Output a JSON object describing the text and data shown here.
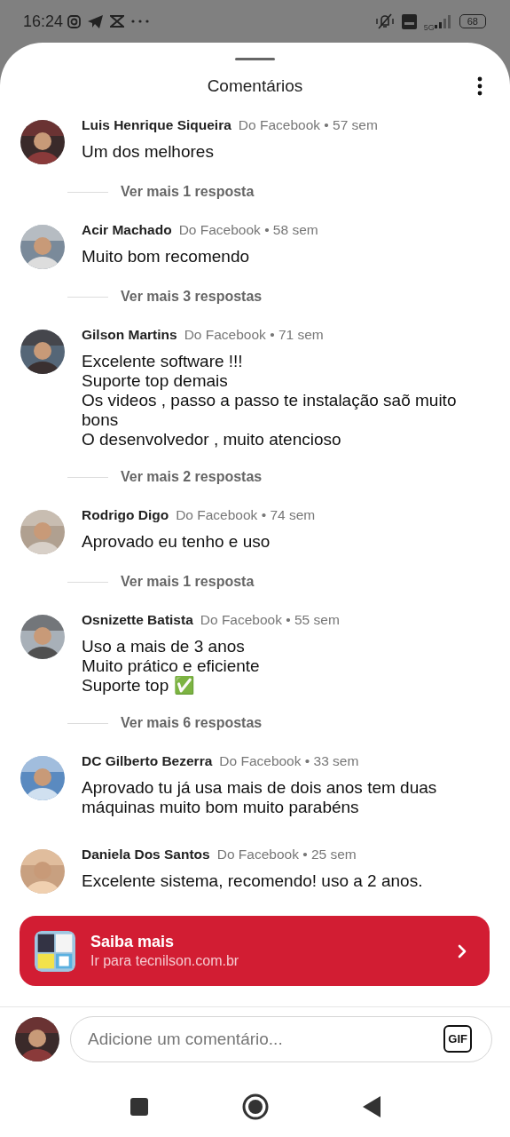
{
  "status_bar": {
    "time": "16:24",
    "network": "5G",
    "battery": "68"
  },
  "sheet": {
    "title": "Comentários"
  },
  "comments": [
    {
      "author": "Luis Henrique Siqueira",
      "meta": "Do Facebook • 57 sem",
      "lines": [
        "Um dos melhores"
      ],
      "replies": "Ver mais 1 resposta"
    },
    {
      "author": "Acir Machado",
      "meta": "Do Facebook • 58 sem",
      "lines": [
        "Muito bom recomendo"
      ],
      "replies": "Ver mais 3 respostas"
    },
    {
      "author": "Gilson Martins",
      "meta": "Do Facebook • 71 sem",
      "lines": [
        "Excelente software !!!",
        "Suporte top demais",
        "Os videos , passo a passo te instalação saõ muito bons",
        "O desenvolvedor , muito atencioso"
      ],
      "replies": "Ver mais 2 respostas"
    },
    {
      "author": "Rodrigo Digo",
      "meta": "Do Facebook • 74 sem",
      "lines": [
        "Aprovado eu tenho e uso"
      ],
      "replies": "Ver mais 1 resposta"
    },
    {
      "author": "Osnizette Batista",
      "meta": "Do Facebook • 55 sem",
      "lines": [
        "Uso a mais de 3 anos",
        "Muito prático e eficiente",
        "Suporte top ✅"
      ],
      "replies": "Ver mais 6 respostas"
    },
    {
      "author": "DC Gilberto Bezerra",
      "meta": "Do Facebook • 33 sem",
      "lines": [
        "Aprovado tu já usa mais de dois anos tem duas máquinas muito bom muito parabéns"
      ]
    },
    {
      "author": "Daniela Dos Santos",
      "meta": "Do Facebook • 25 sem",
      "lines": [
        "Excelente sistema, recomendo! uso a 2 anos."
      ]
    }
  ],
  "promo": {
    "title": "Saiba mais",
    "subtitle": "Ir para tecnilson.com.br"
  },
  "composer": {
    "placeholder": "Adicione um comentário...",
    "gif": "GIF"
  }
}
